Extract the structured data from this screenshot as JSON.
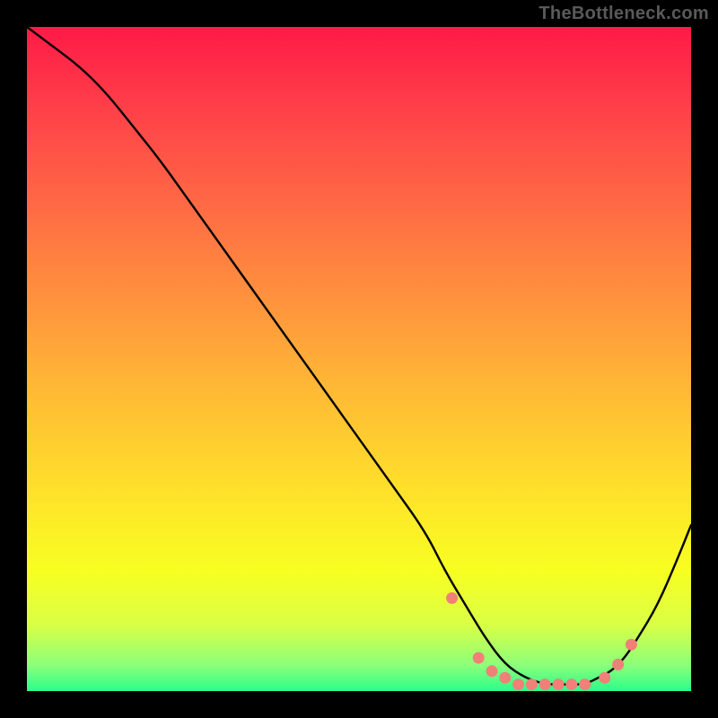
{
  "watermark": "TheBottleneck.com",
  "chart_data": {
    "type": "line",
    "title": "",
    "xlabel": "",
    "ylabel": "",
    "xlim": [
      0,
      100
    ],
    "ylim": [
      0,
      100
    ],
    "curve": {
      "x": [
        0,
        4,
        8,
        12,
        16,
        20,
        25,
        30,
        35,
        40,
        45,
        50,
        55,
        60,
        63,
        66,
        69,
        72,
        75,
        78,
        81,
        84,
        86,
        88,
        90,
        92,
        95,
        98,
        100
      ],
      "y": [
        100,
        97,
        94,
        90,
        85,
        80,
        73,
        66,
        59,
        52,
        45,
        38,
        31,
        24,
        18,
        13,
        8,
        4,
        2,
        1,
        1,
        1,
        2,
        3,
        5,
        8,
        13,
        20,
        25
      ]
    },
    "dots": {
      "x": [
        64,
        68,
        70,
        72,
        74,
        76,
        78,
        80,
        82,
        84,
        87,
        89,
        91
      ],
      "y": [
        14,
        5,
        3,
        2,
        1,
        1,
        1,
        1,
        1,
        1,
        2,
        4,
        7
      ]
    },
    "dot_color": "#f08078",
    "dot_radius_px": 6.5
  }
}
